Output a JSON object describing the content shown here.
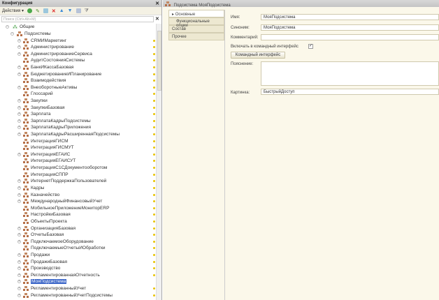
{
  "config_panel": {
    "title": "Конфигурация",
    "actions_label": "Действия ▾",
    "search_placeholder": "Поиск (Ctrl+Alt+M)",
    "tree": {
      "root": "Общие",
      "group": "Подсистемы",
      "items": [
        {
          "label": "CRMИМаркетинг",
          "expandable": true,
          "marked": true
        },
        {
          "label": "Администрирование",
          "expandable": true,
          "marked": true
        },
        {
          "label": "АдминистрированиеСервиса",
          "expandable": true,
          "marked": true
        },
        {
          "label": "АудитСостоянияСистемы",
          "expandable": false,
          "marked": true
        },
        {
          "label": "БанкИКассаБазовая",
          "expandable": true,
          "marked": true
        },
        {
          "label": "БюджетированиеИПланирование",
          "expandable": true,
          "marked": true
        },
        {
          "label": "Взаимодействия",
          "expandable": false,
          "marked": true
        },
        {
          "label": "ВнеоборотныеАктивы",
          "expandable": true,
          "marked": true
        },
        {
          "label": "Глоссарий",
          "expandable": false,
          "marked": true
        },
        {
          "label": "Закупки",
          "expandable": true,
          "marked": true
        },
        {
          "label": "ЗакупкиБазовая",
          "expandable": true,
          "marked": true
        },
        {
          "label": "Зарплата",
          "expandable": true,
          "marked": true
        },
        {
          "label": "ЗарплатаКадрыПодсистемы",
          "expandable": true,
          "marked": true
        },
        {
          "label": "ЗарплатаКадрыПриложения",
          "expandable": true,
          "marked": true
        },
        {
          "label": "ЗарплатаКадрыРасширеннаяПодсистемы",
          "expandable": true,
          "marked": true
        },
        {
          "label": "ИнтеграцияГИСМ",
          "expandable": false,
          "marked": true
        },
        {
          "label": "ИнтеграцияГИСМУТ",
          "expandable": false,
          "marked": true
        },
        {
          "label": "ИнтеграцияЕГАИС",
          "expandable": true,
          "marked": true
        },
        {
          "label": "ИнтеграцияЕГАИСУТ",
          "expandable": false,
          "marked": true
        },
        {
          "label": "ИнтеграцияС1СДокументооборотом",
          "expandable": false,
          "marked": true
        },
        {
          "label": "ИнтеграцияСППР",
          "expandable": false,
          "marked": true
        },
        {
          "label": "ИнтернетПоддержкаПользователей",
          "expandable": true,
          "marked": true
        },
        {
          "label": "Кадры",
          "expandable": true,
          "marked": true
        },
        {
          "label": "Казначейство",
          "expandable": true,
          "marked": true
        },
        {
          "label": "МеждународныйФинансовыйУчет",
          "expandable": true,
          "marked": true
        },
        {
          "label": "МобильноеПриложениеМониторERP",
          "expandable": false,
          "marked": true
        },
        {
          "label": "НастройкиБазовая",
          "expandable": false,
          "marked": true
        },
        {
          "label": "ОбъектыПроекта",
          "expandable": false,
          "marked": true
        },
        {
          "label": "ОрганизацияБазовая",
          "expandable": true,
          "marked": true
        },
        {
          "label": "ОтчетыБазовая",
          "expandable": true,
          "marked": true
        },
        {
          "label": "ПодключаемоеОборудование",
          "expandable": true,
          "marked": true
        },
        {
          "label": "ПодключаемыеОтчетыИОбработки",
          "expandable": false,
          "marked": true
        },
        {
          "label": "Продажи",
          "expandable": true,
          "marked": true
        },
        {
          "label": "ПродажиБазовая",
          "expandable": true,
          "marked": true
        },
        {
          "label": "Производство",
          "expandable": true,
          "marked": true
        },
        {
          "label": "РегламентированнаяОтчетность",
          "expandable": true,
          "marked": true
        },
        {
          "label": "МояПодсистема",
          "expandable": true,
          "marked": false,
          "selected": true
        },
        {
          "label": "РегламентированныйУчет",
          "expandable": true,
          "marked": true
        },
        {
          "label": "РегламентированныйУчетПодсистемы",
          "expandable": true,
          "marked": true
        }
      ]
    }
  },
  "editor": {
    "title": "Подсистема МояПодсистема",
    "tabs": [
      {
        "label": "Основные",
        "active": true
      },
      {
        "label": "Функциональные опции"
      },
      {
        "label": "Состав"
      },
      {
        "label": "Прочее"
      }
    ],
    "fields": {
      "name_label": "Имя:",
      "name_value": "МояПодсистема",
      "synonym_label": "Синоним:",
      "synonym_value": "МояПодсистема",
      "comment_label": "Комментарий:",
      "comment_value": "",
      "include_label": "Включать в командный интерфейс",
      "include_checked": true,
      "command_button": "Командный интерфейс",
      "explanation_label": "Пояснение:",
      "explanation_value": "",
      "picture_label": "Картинка:",
      "picture_value": "БыстрыйДоступ"
    }
  },
  "colors": {
    "selection": "#3b66c8",
    "form_bg": "#fbf8ea",
    "marker": "#e8c300"
  }
}
